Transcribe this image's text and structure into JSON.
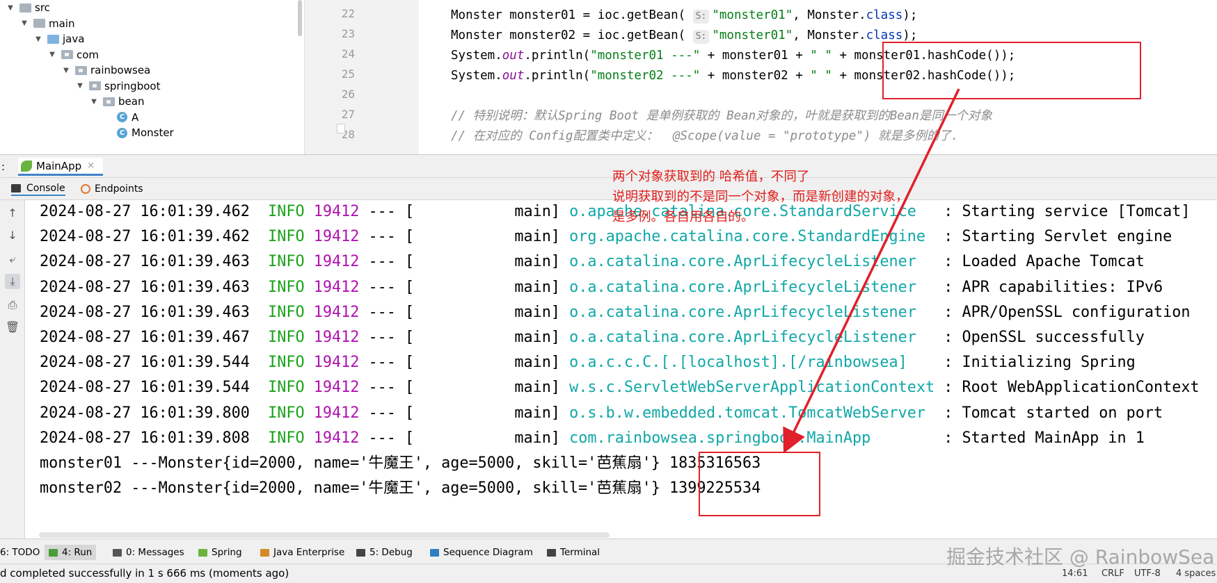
{
  "project_tree": {
    "items": [
      {
        "label": "src",
        "indent": 0,
        "expanded": true,
        "icon": "folder-icon"
      },
      {
        "label": "main",
        "indent": 1,
        "expanded": true,
        "icon": "folder-icon"
      },
      {
        "label": "java",
        "indent": 2,
        "expanded": true,
        "icon": "source-folder-icon"
      },
      {
        "label": "com",
        "indent": 3,
        "expanded": true,
        "icon": "package-icon"
      },
      {
        "label": "rainbowsea",
        "indent": 4,
        "expanded": true,
        "icon": "package-icon"
      },
      {
        "label": "springboot",
        "indent": 5,
        "expanded": true,
        "icon": "package-icon"
      },
      {
        "label": "bean",
        "indent": 6,
        "expanded": true,
        "icon": "package-icon"
      },
      {
        "label": "A",
        "indent": 7,
        "expanded": null,
        "icon": "class-icon"
      },
      {
        "label": "Monster",
        "indent": 7,
        "expanded": null,
        "icon": "class-icon"
      }
    ]
  },
  "editor": {
    "line_numbers": [
      "22",
      "23",
      "24",
      "25",
      "26",
      "27",
      "28"
    ],
    "lines": [
      [
        {
          "t": "Monster monster01 = ioc.getBean( ",
          "c": "plain"
        },
        {
          "t": "S:",
          "c": "hint"
        },
        {
          "t": "\"monster01\"",
          "c": "str"
        },
        {
          "t": ", Monster.",
          "c": "plain"
        },
        {
          "t": "class",
          "c": "kw"
        },
        {
          "t": ");",
          "c": "plain"
        }
      ],
      [
        {
          "t": "Monster monster02 = ioc.getBean( ",
          "c": "plain"
        },
        {
          "t": "S:",
          "c": "hint"
        },
        {
          "t": "\"monster01\"",
          "c": "str"
        },
        {
          "t": ", Monster.",
          "c": "plain"
        },
        {
          "t": "class",
          "c": "kw"
        },
        {
          "t": ");",
          "c": "plain"
        }
      ],
      [
        {
          "t": "System.",
          "c": "plain"
        },
        {
          "t": "out",
          "c": "static"
        },
        {
          "t": ".println(",
          "c": "plain"
        },
        {
          "t": "\"monster01 ---\"",
          "c": "str"
        },
        {
          "t": " + monster01 + ",
          "c": "plain"
        },
        {
          "t": "\" \"",
          "c": "str"
        },
        {
          "t": " + monster01.hashCode());",
          "c": "plain"
        }
      ],
      [
        {
          "t": "System.",
          "c": "plain"
        },
        {
          "t": "out",
          "c": "static"
        },
        {
          "t": ".println(",
          "c": "plain"
        },
        {
          "t": "\"monster02 ---\"",
          "c": "str"
        },
        {
          "t": " + monster02 + ",
          "c": "plain"
        },
        {
          "t": "\" \"",
          "c": "str"
        },
        {
          "t": " + monster02.hashCode());",
          "c": "plain"
        }
      ],
      [],
      [
        {
          "t": "// 特别说明：默认Spring Boot 是单例获取的 Bean对象的，叶就是获取到的Bean是同一个对象",
          "c": "cmt"
        }
      ],
      [
        {
          "t": "// 在对应的 Config配置类中定义：  @Scope(value = \"prototype\") 就是多例的了.",
          "c": "cmt"
        }
      ]
    ]
  },
  "run_window": {
    "colon": ":",
    "tab_label": "MainApp",
    "tab_close": "×",
    "console_tab": "Console",
    "endpoints_tab": "Endpoints"
  },
  "console": {
    "logs": [
      {
        "ts": "2024-08-27 16:01:39.462",
        "level": "INFO",
        "pid": "19412",
        "sep": "---",
        "thread": "[           main]",
        "logger": "o.apache.catalina.core.StandardService  ",
        "msg": ": Starting service [Tomcat]"
      },
      {
        "ts": "2024-08-27 16:01:39.462",
        "level": "INFO",
        "pid": "19412",
        "sep": "---",
        "thread": "[           main]",
        "logger": "org.apache.catalina.core.StandardEngine ",
        "msg": ": Starting Servlet engine"
      },
      {
        "ts": "2024-08-27 16:01:39.463",
        "level": "INFO",
        "pid": "19412",
        "sep": "---",
        "thread": "[           main]",
        "logger": "o.a.catalina.core.AprLifecycleListener  ",
        "msg": ": Loaded Apache Tomcat"
      },
      {
        "ts": "2024-08-27 16:01:39.463",
        "level": "INFO",
        "pid": "19412",
        "sep": "---",
        "thread": "[           main]",
        "logger": "o.a.catalina.core.AprLifecycleListener  ",
        "msg": ": APR capabilities: IPv6"
      },
      {
        "ts": "2024-08-27 16:01:39.463",
        "level": "INFO",
        "pid": "19412",
        "sep": "---",
        "thread": "[           main]",
        "logger": "o.a.catalina.core.AprLifecycleListener  ",
        "msg": ": APR/OpenSSL configuration"
      },
      {
        "ts": "2024-08-27 16:01:39.467",
        "level": "INFO",
        "pid": "19412",
        "sep": "---",
        "thread": "[           main]",
        "logger": "o.a.catalina.core.AprLifecycleListener  ",
        "msg": ": OpenSSL successfully"
      },
      {
        "ts": "2024-08-27 16:01:39.544",
        "level": "INFO",
        "pid": "19412",
        "sep": "---",
        "thread": "[           main]",
        "logger": "o.a.c.c.C.[.[localhost].[/rainbowsea]   ",
        "msg": ": Initializing Spring"
      },
      {
        "ts": "2024-08-27 16:01:39.544",
        "level": "INFO",
        "pid": "19412",
        "sep": "---",
        "thread": "[           main]",
        "logger": "w.s.c.ServletWebServerApplicationContext",
        "msg": ": Root WebApplicationContext"
      },
      {
        "ts": "2024-08-27 16:01:39.800",
        "level": "INFO",
        "pid": "19412",
        "sep": "---",
        "thread": "[           main]",
        "logger": "o.s.b.w.embedded.tomcat.TomcatWebServer ",
        "msg": ": Tomcat started on port"
      },
      {
        "ts": "2024-08-27 16:01:39.808",
        "level": "INFO",
        "pid": "19412",
        "sep": "---",
        "thread": "[           main]",
        "logger": "com.rainbowsea.springboot.MainApp       ",
        "msg": ": Started MainApp in 1"
      }
    ],
    "output": [
      "monster01 ---Monster{id=2000, name='牛魔王', age=5000, skill='芭蕉扇'} 1835316563",
      "monster02 ---Monster{id=2000, name='牛魔王', age=5000, skill='芭蕉扇'} 1399225534"
    ]
  },
  "annotation": {
    "text": "两个对象获取到的 哈希值，不同了\n说明获取到的不是同一个对象，而是新创建的对象，\n是多例。各自用各自的。",
    "color": "#e0201c"
  },
  "bottom_tabs": [
    {
      "label": "6: TODO",
      "icon": "todo-icon"
    },
    {
      "label": "4: Run",
      "icon": "run-icon",
      "active": true
    },
    {
      "label": "0: Messages",
      "icon": "messages-icon"
    },
    {
      "label": "Spring",
      "icon": "spring-icon"
    },
    {
      "label": "Java Enterprise",
      "icon": "java-enterprise-icon"
    },
    {
      "label": "5: Debug",
      "icon": "debug-icon"
    },
    {
      "label": "Sequence Diagram",
      "icon": "sequence-diagram-icon"
    },
    {
      "label": "Terminal",
      "icon": "terminal-icon"
    }
  ],
  "status_bar": {
    "message": "d completed successfully in 1 s 666 ms (moments ago)",
    "position": "14:61",
    "line_ending": "CRLF",
    "encoding": "UTF-8",
    "indent": "4 spaces"
  },
  "watermark": "掘金技术社区 @ RainbowSea"
}
